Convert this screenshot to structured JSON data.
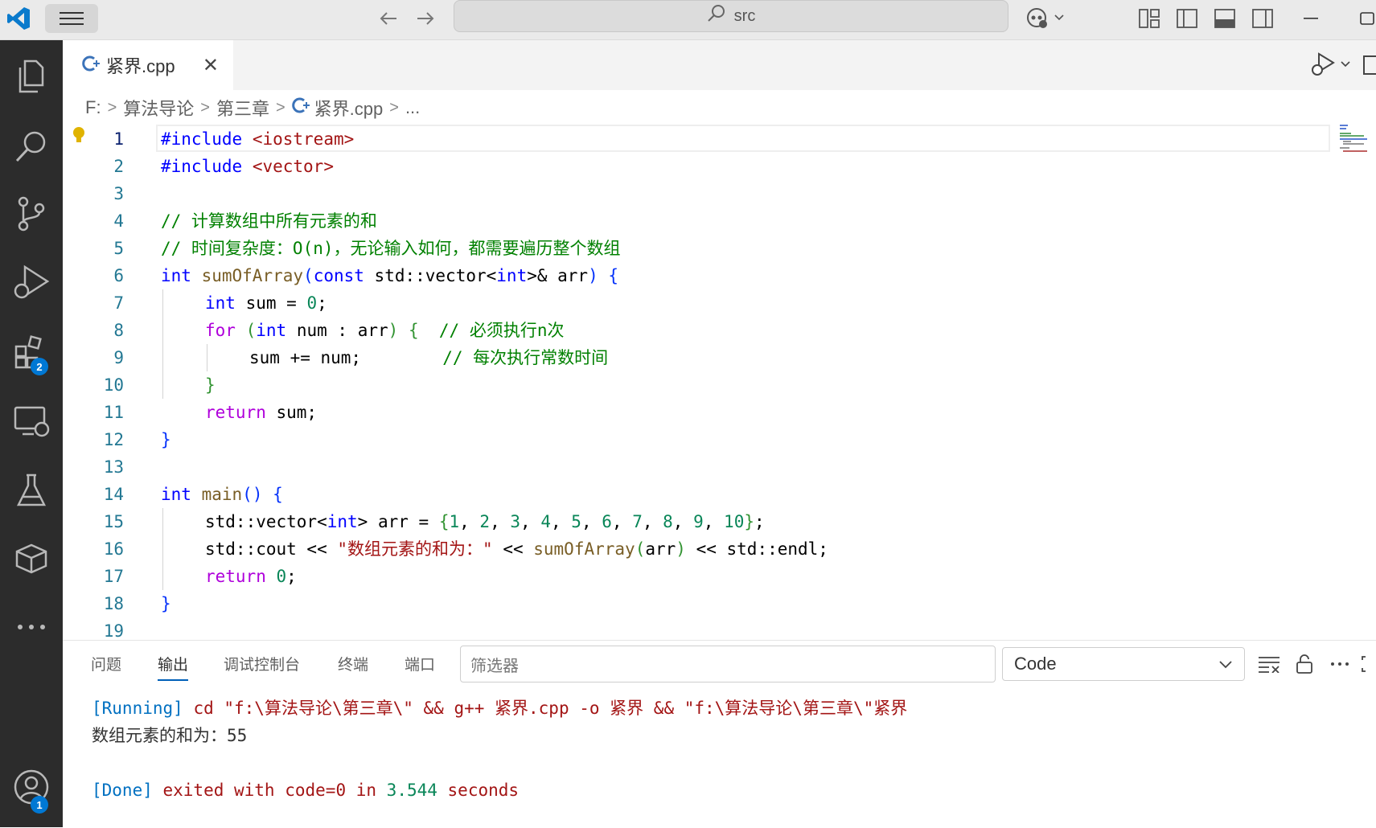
{
  "titlebar": {
    "search_text": "src"
  },
  "activity": {
    "extensions_badge": "2",
    "accounts_badge": "1"
  },
  "tab": {
    "name": "紧界.cpp",
    "close": "✕"
  },
  "breadcrumb": [
    "F:",
    "算法导论",
    "第三章",
    "紧界.cpp",
    "..."
  ],
  "editor": {
    "line_numbers": [
      "1",
      "2",
      "3",
      "4",
      "5",
      "6",
      "7",
      "8",
      "9",
      "10",
      "11",
      "12",
      "13",
      "14",
      "15",
      "16",
      "17",
      "18",
      "19"
    ],
    "active_line": 1
  },
  "code": {
    "l1_pp": "#include",
    "l1_hdr": "<iostream>",
    "l2_pp": "#include",
    "l2_hdr": "<vector>",
    "l4": "// 计算数组中所有元素的和",
    "l5": "// 时间复杂度：O(n)，无论输入如何，都需要遍历整个数组",
    "l6_kw": "int",
    "l6_fn": "sumOfArray",
    "l6_open": "(",
    "l6_const": "const",
    "l6_mid1": " std::vector<",
    "l6_int": "int",
    "l6_mid2": ">& arr",
    "l6_close": ")",
    "l6_brace": "{",
    "l7_kw": "int",
    "l7_rest": " sum = ",
    "l7_num": "0",
    "l7_end": ";",
    "l8_for": "for",
    "l8_open": "(",
    "l8_int": "int",
    "l8_mid": " num : arr",
    "l8_close": ")",
    "l8_brace": "{",
    "l8_cm": "// 必须执行n次",
    "l9_code": "sum += num;",
    "l9_cm": "// 每次执行常数时间",
    "l10": "}",
    "l11_kw": "return",
    "l11_rest": " sum;",
    "l12": "}",
    "l14_kw": "int",
    "l14_fn": "main",
    "l14_parens": "()",
    "l14_brace": "{",
    "l15_a": "std::vector<",
    "l15_int": "int",
    "l15_b": "> arr = ",
    "l15_open": "{",
    "l15_nums": [
      "1",
      "2",
      "3",
      "4",
      "5",
      "6",
      "7",
      "8",
      "9",
      "10"
    ],
    "l15_close": "}",
    "l15_end": ";",
    "l16_a": "std::cout << ",
    "l16_str": "\"数组元素的和为：\"",
    "l16_b": " << ",
    "l16_fn": "sumOfArray",
    "l16_open": "(",
    "l16_arg": "arr",
    "l16_close": ")",
    "l16_c": " << std::endl;",
    "l17_kw": "return",
    "l17_num": "0",
    "l17_end": ";",
    "l18": "}"
  },
  "panel": {
    "tabs": [
      "问题",
      "输出",
      "调试控制台",
      "终端",
      "端口"
    ],
    "active_tab": "输出",
    "filter_placeholder": "筛选器",
    "channel": "Code",
    "output": {
      "running_tag": "[Running]",
      "running_cmd": " cd \"f:\\算法导论\\第三章\\\" && g++ 紧界.cpp -o 紧界 && \"f:\\算法导论\\第三章\\\"紧界",
      "result": "数组元素的和为：55",
      "done_tag": "[Done]",
      "done_a": " exited with ",
      "done_code": "code=0",
      "done_b": " in ",
      "done_secs": "3.544",
      "done_c": " seconds"
    }
  }
}
